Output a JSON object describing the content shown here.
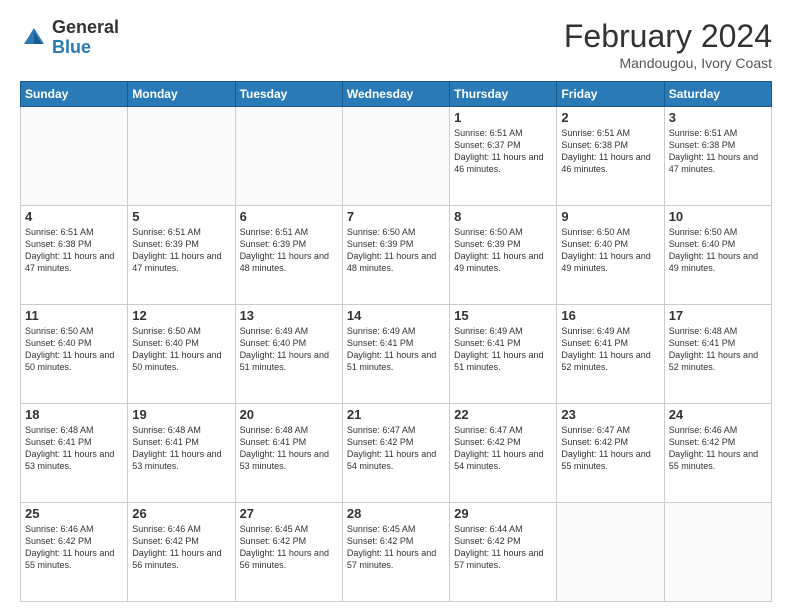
{
  "logo": {
    "general": "General",
    "blue": "Blue"
  },
  "title": "February 2024",
  "subtitle": "Mandougou, Ivory Coast",
  "days_header": [
    "Sunday",
    "Monday",
    "Tuesday",
    "Wednesday",
    "Thursday",
    "Friday",
    "Saturday"
  ],
  "weeks": [
    [
      {
        "day": "",
        "info": ""
      },
      {
        "day": "",
        "info": ""
      },
      {
        "day": "",
        "info": ""
      },
      {
        "day": "",
        "info": ""
      },
      {
        "day": "1",
        "info": "Sunrise: 6:51 AM\nSunset: 6:37 PM\nDaylight: 11 hours and 46 minutes."
      },
      {
        "day": "2",
        "info": "Sunrise: 6:51 AM\nSunset: 6:38 PM\nDaylight: 11 hours and 46 minutes."
      },
      {
        "day": "3",
        "info": "Sunrise: 6:51 AM\nSunset: 6:38 PM\nDaylight: 11 hours and 47 minutes."
      }
    ],
    [
      {
        "day": "4",
        "info": "Sunrise: 6:51 AM\nSunset: 6:38 PM\nDaylight: 11 hours and 47 minutes."
      },
      {
        "day": "5",
        "info": "Sunrise: 6:51 AM\nSunset: 6:39 PM\nDaylight: 11 hours and 47 minutes."
      },
      {
        "day": "6",
        "info": "Sunrise: 6:51 AM\nSunset: 6:39 PM\nDaylight: 11 hours and 48 minutes."
      },
      {
        "day": "7",
        "info": "Sunrise: 6:50 AM\nSunset: 6:39 PM\nDaylight: 11 hours and 48 minutes."
      },
      {
        "day": "8",
        "info": "Sunrise: 6:50 AM\nSunset: 6:39 PM\nDaylight: 11 hours and 49 minutes."
      },
      {
        "day": "9",
        "info": "Sunrise: 6:50 AM\nSunset: 6:40 PM\nDaylight: 11 hours and 49 minutes."
      },
      {
        "day": "10",
        "info": "Sunrise: 6:50 AM\nSunset: 6:40 PM\nDaylight: 11 hours and 49 minutes."
      }
    ],
    [
      {
        "day": "11",
        "info": "Sunrise: 6:50 AM\nSunset: 6:40 PM\nDaylight: 11 hours and 50 minutes."
      },
      {
        "day": "12",
        "info": "Sunrise: 6:50 AM\nSunset: 6:40 PM\nDaylight: 11 hours and 50 minutes."
      },
      {
        "day": "13",
        "info": "Sunrise: 6:49 AM\nSunset: 6:40 PM\nDaylight: 11 hours and 51 minutes."
      },
      {
        "day": "14",
        "info": "Sunrise: 6:49 AM\nSunset: 6:41 PM\nDaylight: 11 hours and 51 minutes."
      },
      {
        "day": "15",
        "info": "Sunrise: 6:49 AM\nSunset: 6:41 PM\nDaylight: 11 hours and 51 minutes."
      },
      {
        "day": "16",
        "info": "Sunrise: 6:49 AM\nSunset: 6:41 PM\nDaylight: 11 hours and 52 minutes."
      },
      {
        "day": "17",
        "info": "Sunrise: 6:48 AM\nSunset: 6:41 PM\nDaylight: 11 hours and 52 minutes."
      }
    ],
    [
      {
        "day": "18",
        "info": "Sunrise: 6:48 AM\nSunset: 6:41 PM\nDaylight: 11 hours and 53 minutes."
      },
      {
        "day": "19",
        "info": "Sunrise: 6:48 AM\nSunset: 6:41 PM\nDaylight: 11 hours and 53 minutes."
      },
      {
        "day": "20",
        "info": "Sunrise: 6:48 AM\nSunset: 6:41 PM\nDaylight: 11 hours and 53 minutes."
      },
      {
        "day": "21",
        "info": "Sunrise: 6:47 AM\nSunset: 6:42 PM\nDaylight: 11 hours and 54 minutes."
      },
      {
        "day": "22",
        "info": "Sunrise: 6:47 AM\nSunset: 6:42 PM\nDaylight: 11 hours and 54 minutes."
      },
      {
        "day": "23",
        "info": "Sunrise: 6:47 AM\nSunset: 6:42 PM\nDaylight: 11 hours and 55 minutes."
      },
      {
        "day": "24",
        "info": "Sunrise: 6:46 AM\nSunset: 6:42 PM\nDaylight: 11 hours and 55 minutes."
      }
    ],
    [
      {
        "day": "25",
        "info": "Sunrise: 6:46 AM\nSunset: 6:42 PM\nDaylight: 11 hours and 55 minutes."
      },
      {
        "day": "26",
        "info": "Sunrise: 6:46 AM\nSunset: 6:42 PM\nDaylight: 11 hours and 56 minutes."
      },
      {
        "day": "27",
        "info": "Sunrise: 6:45 AM\nSunset: 6:42 PM\nDaylight: 11 hours and 56 minutes."
      },
      {
        "day": "28",
        "info": "Sunrise: 6:45 AM\nSunset: 6:42 PM\nDaylight: 11 hours and 57 minutes."
      },
      {
        "day": "29",
        "info": "Sunrise: 6:44 AM\nSunset: 6:42 PM\nDaylight: 11 hours and 57 minutes."
      },
      {
        "day": "",
        "info": ""
      },
      {
        "day": "",
        "info": ""
      }
    ]
  ]
}
